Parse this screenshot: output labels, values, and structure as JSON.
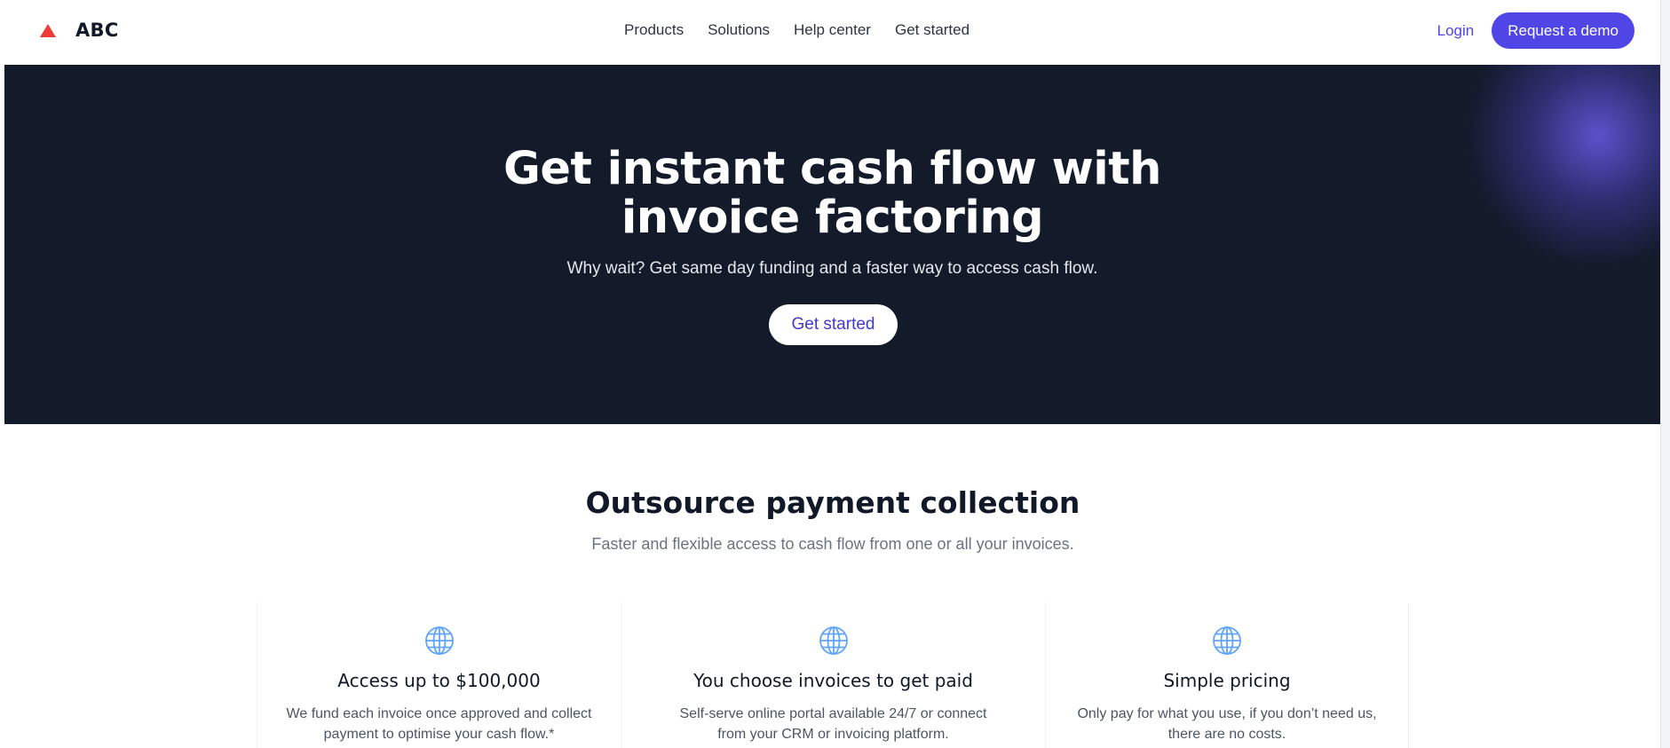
{
  "brand": {
    "name": "ABC",
    "logo_icon": "red-triangle-icon",
    "logo_color": "#ef3b36"
  },
  "nav": {
    "links": [
      {
        "label": "Products"
      },
      {
        "label": "Solutions"
      },
      {
        "label": "Help center"
      },
      {
        "label": "Get started"
      }
    ],
    "login_label": "Login",
    "demo_label": "Request a demo"
  },
  "hero": {
    "title": "Get instant cash flow with invoice factoring",
    "subtitle": "Why wait? Get same day funding and a faster way to access cash flow.",
    "cta_label": "Get started",
    "background_color": "#131a2a"
  },
  "features_section": {
    "title": "Outsource payment collection",
    "subtitle": "Faster and flexible access to cash flow from one or all your invoices.",
    "items": [
      {
        "icon": "globe-icon",
        "title": "Access up to $100,000",
        "description": "We fund each invoice once approved and collect payment to optimise your cash flow.*"
      },
      {
        "icon": "globe-icon",
        "title": "You choose invoices to get paid",
        "description": "Self-serve online portal available 24/7 or connect from your CRM or invoicing platform."
      },
      {
        "icon": "globe-icon",
        "title": "Simple pricing",
        "description": "Only pay for what you use, if you don’t need us, there are no costs."
      }
    ]
  },
  "colors": {
    "accent": "#4f46e5",
    "icon_blue": "#60a5fa"
  }
}
